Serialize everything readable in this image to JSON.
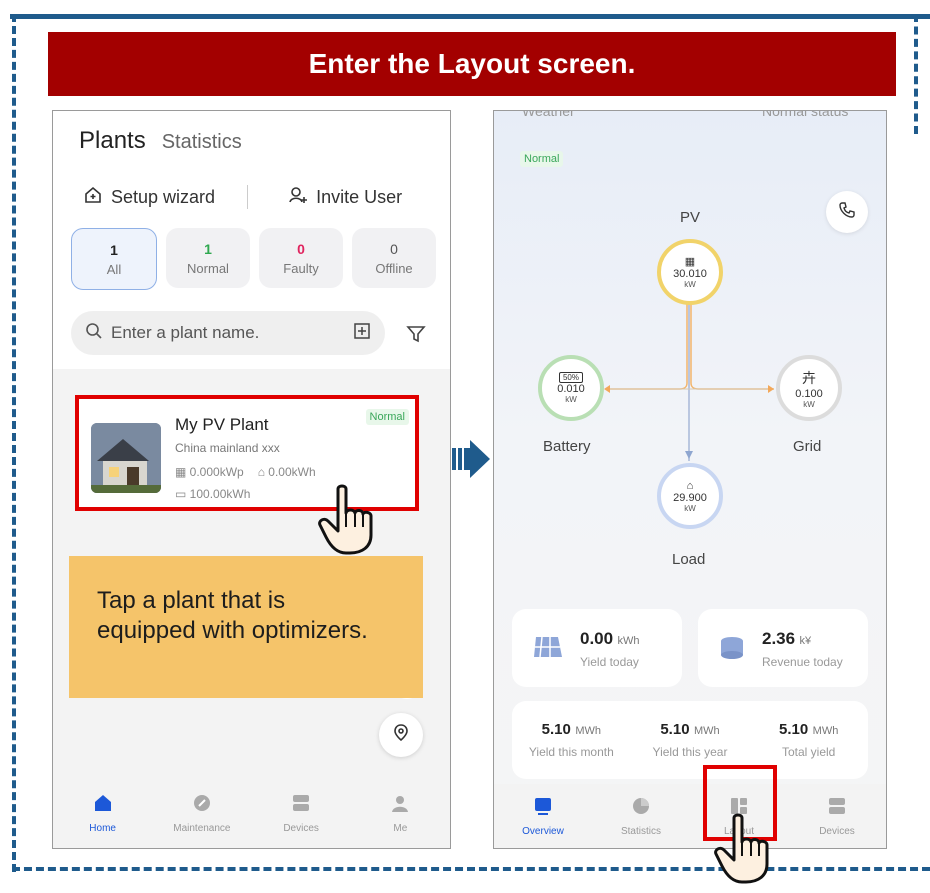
{
  "banner": {
    "title": "Enter the Layout screen."
  },
  "left_phone": {
    "tabs": {
      "active": "Plants",
      "inactive": "Statistics"
    },
    "actions": {
      "setup": "Setup wizard",
      "invite": "Invite User"
    },
    "stats": [
      {
        "count": "1",
        "label": "All"
      },
      {
        "count": "1",
        "label": "Normal"
      },
      {
        "count": "0",
        "label": "Faulty"
      },
      {
        "count": "0",
        "label": "Offline"
      }
    ],
    "stat_colors": {
      "normal": "#2fa84f",
      "faulty": "#e0245e"
    },
    "search": {
      "placeholder": "Enter a plant name."
    },
    "plant": {
      "name": "My PV Plant",
      "location": "China mainland xxx",
      "status": "Normal",
      "capacity_kwp": "0.000kWp",
      "power_kwh": "0.00kWh",
      "storage": "100.00kWh"
    },
    "tip": "Tap a plant that is equipped with optimizers.",
    "nav": [
      {
        "label": "Home",
        "icon": "home-icon"
      },
      {
        "label": "Maintenance",
        "icon": "maintenance-icon"
      },
      {
        "label": "Devices",
        "icon": "devices-icon"
      },
      {
        "label": "Me",
        "icon": "me-icon"
      }
    ]
  },
  "right_phone": {
    "top_cut_left": "Weather",
    "top_cut_right": "Normal status",
    "status": "Normal",
    "nodes": {
      "pv": {
        "label": "PV",
        "value": "30.010",
        "unit": "kW"
      },
      "battery": {
        "label": "Battery",
        "value": "0.010",
        "unit": "kW",
        "soc": "50%"
      },
      "grid": {
        "label": "Grid",
        "value": "0.100",
        "unit": "kW"
      },
      "load": {
        "label": "Load",
        "value": "29.900",
        "unit": "kW"
      }
    },
    "yield_today": {
      "value": "0.00",
      "unit": "kWh",
      "label": "Yield today"
    },
    "revenue_today": {
      "value": "2.36",
      "unit": "k¥",
      "label": "Revenue today"
    },
    "totals": [
      {
        "value": "5.10",
        "unit": "MWh",
        "label": "Yield this month"
      },
      {
        "value": "5.10",
        "unit": "MWh",
        "label": "Yield this year"
      },
      {
        "value": "5.10",
        "unit": "MWh",
        "label": "Total yield"
      }
    ],
    "nav": [
      {
        "label": "Overview",
        "icon": "overview-icon"
      },
      {
        "label": "Statistics",
        "icon": "statistics-icon"
      },
      {
        "label": "Layout",
        "icon": "layout-icon"
      },
      {
        "label": "Devices",
        "icon": "devices-icon"
      }
    ]
  },
  "colors": {
    "banner": "#a30000",
    "frame": "#1f5b8c",
    "highlight": "#e00000",
    "tip": "#f5c46a",
    "accent": "#1c58d8"
  }
}
